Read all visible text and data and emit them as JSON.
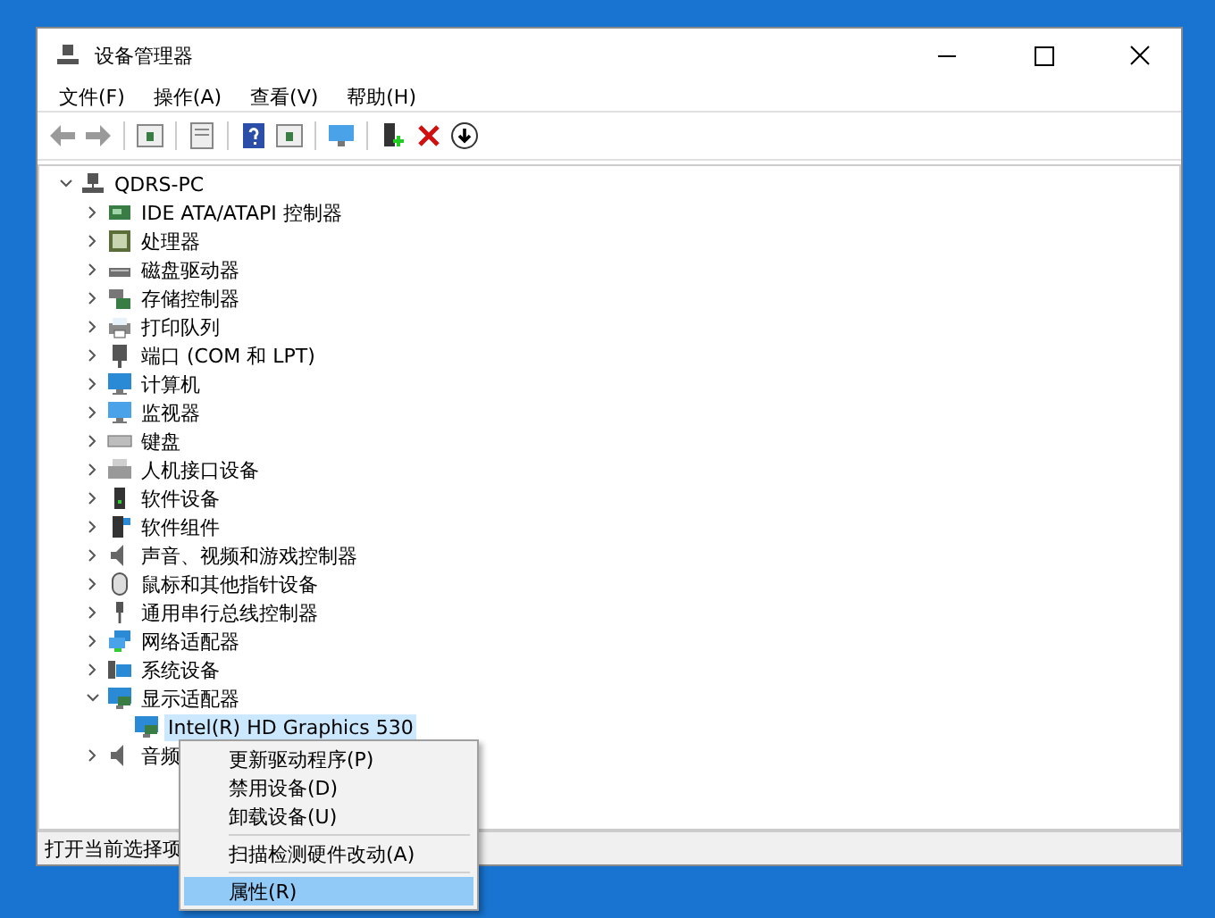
{
  "window": {
    "title": "设备管理器"
  },
  "menu_bar": [
    {
      "label": "文件(F)"
    },
    {
      "label": "操作(A)"
    },
    {
      "label": "查看(V)"
    },
    {
      "label": "帮助(H)"
    }
  ],
  "tree": {
    "label": "QDRS-PC",
    "expanded": true,
    "selected": false,
    "children": [
      {
        "label": "IDE ATA/ATAPI 控制器",
        "expanded": false,
        "selected": false
      },
      {
        "label": "处理器",
        "expanded": false,
        "selected": false
      },
      {
        "label": "磁盘驱动器",
        "expanded": false,
        "selected": false
      },
      {
        "label": "存储控制器",
        "expanded": false,
        "selected": false
      },
      {
        "label": "打印队列",
        "expanded": false,
        "selected": false
      },
      {
        "label": "端口 (COM 和 LPT)",
        "expanded": false,
        "selected": false
      },
      {
        "label": "计算机",
        "expanded": false,
        "selected": false
      },
      {
        "label": "监视器",
        "expanded": false,
        "selected": false
      },
      {
        "label": "键盘",
        "expanded": false,
        "selected": false
      },
      {
        "label": "人机接口设备",
        "expanded": false,
        "selected": false
      },
      {
        "label": "软件设备",
        "expanded": false,
        "selected": false
      },
      {
        "label": "软件组件",
        "expanded": false,
        "selected": false
      },
      {
        "label": "声音、视频和游戏控制器",
        "expanded": false,
        "selected": false
      },
      {
        "label": "鼠标和其他指针设备",
        "expanded": false,
        "selected": false
      },
      {
        "label": "通用串行总线控制器",
        "expanded": false,
        "selected": false
      },
      {
        "label": "网络适配器",
        "expanded": false,
        "selected": false
      },
      {
        "label": "系统设备",
        "expanded": false,
        "selected": false
      },
      {
        "label": "显示适配器",
        "expanded": true,
        "selected": false,
        "children": [
          {
            "label": "Intel(R) HD Graphics 530",
            "selected": true
          }
        ]
      },
      {
        "label": "音频",
        "expanded": false,
        "selected": false
      }
    ]
  },
  "status_bar": "打开当前选择项",
  "context_menu": [
    {
      "kind": "item",
      "label": "更新驱动程序(P)",
      "selected": false
    },
    {
      "kind": "item",
      "label": "禁用设备(D)",
      "selected": false
    },
    {
      "kind": "item",
      "label": "卸载设备(U)",
      "selected": false
    },
    {
      "kind": "separator"
    },
    {
      "kind": "item",
      "label": "扫描检测硬件改动(A)",
      "selected": false
    },
    {
      "kind": "separator"
    },
    {
      "kind": "item",
      "label": "属性(R)",
      "selected": true
    }
  ]
}
